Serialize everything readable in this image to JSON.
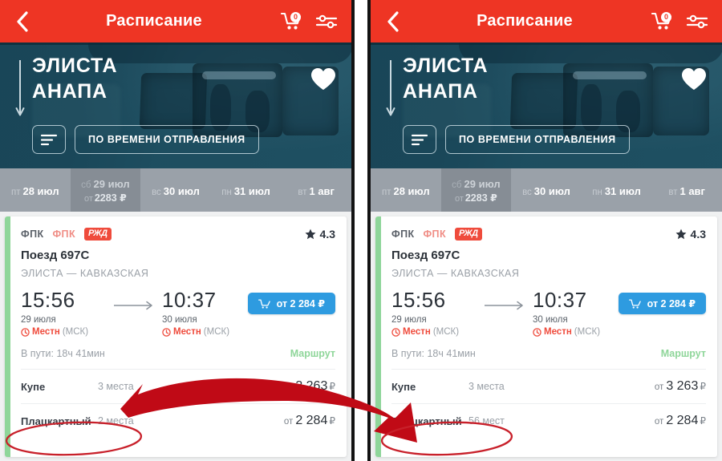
{
  "appbar": {
    "title": "Расписание",
    "back_icon": "chevron-left-icon",
    "cart_icon": "shopping-cart-icon",
    "cart_count": "0",
    "filter_icon": "sliders-filter-icon"
  },
  "hero": {
    "origin": "ЭЛИСТА",
    "destination": "АНАПА",
    "direction_icon": "arrow-down-icon",
    "favorite_icon": "heart-filled-icon",
    "sort_icon": "sort-lines-icon",
    "sort_label": "ПО ВРЕМЕНИ ОТПРАВЛЕНИЯ"
  },
  "dates": [
    {
      "dow": "пт",
      "day": "28 июл",
      "price_prefix": "",
      "price": "",
      "selected": false
    },
    {
      "dow": "сб",
      "day": "29 июл",
      "price_prefix": "от",
      "price": "2283 ₽",
      "selected": true
    },
    {
      "dow": "вс",
      "day": "30 июл",
      "price_prefix": "",
      "price": "",
      "selected": false
    },
    {
      "dow": "пн",
      "day": "31 июл",
      "price_prefix": "",
      "price": "",
      "selected": false
    },
    {
      "dow": "вт",
      "day": "1 авг",
      "price_prefix": "",
      "price": "",
      "selected": false
    }
  ],
  "card": {
    "carrier_1": "ФПК",
    "carrier_2": "ФПК",
    "carrier_logo": "РЖД",
    "rating_icon": "star-filled-icon",
    "rating": "4.3",
    "train_number": "Поезд 697С",
    "train_route": "ЭЛИСТА — КАВКАЗСКАЯ",
    "depart_time": "15:56",
    "depart_date": "29 июля",
    "depart_zone_icon": "clock-icon",
    "depart_zone": "Местн",
    "depart_zone_note": "(МСК)",
    "arrive_time": "10:37",
    "arrive_date": "30 июля",
    "arrive_zone_icon": "clock-icon",
    "arrive_zone": "Местн",
    "arrive_zone_note": "(МСК)",
    "transition_icon": "arrow-right-icon",
    "buy_icon": "shopping-cart-icon",
    "buy_label": "от 2 284 ₽",
    "duration": "В пути: 18ч 41мин",
    "route_link": "Маршрут"
  },
  "classes_left": [
    {
      "name": "Купе",
      "seats": "3 места",
      "price_prefix": "от",
      "price": "3 263",
      "currency": "₽"
    },
    {
      "name": "Плацкартный",
      "seats": "2 места",
      "price_prefix": "от",
      "price": "2 284",
      "currency": "₽"
    }
  ],
  "classes_right": [
    {
      "name": "Купе",
      "seats": "3 места",
      "price_prefix": "от",
      "price": "3 263",
      "currency": "₽"
    },
    {
      "name": "Плацкартный",
      "seats": "56 мест",
      "price_prefix": "от",
      "price": "2 284",
      "currency": "₽"
    }
  ],
  "annotations": {
    "arrow": "red-curved-arrow",
    "ellipse_left": "red-ellipse-highlight",
    "ellipse_right": "red-ellipse-highlight",
    "accent_red": "#C00A16",
    "accent_ellipse": "#C8202A"
  },
  "colors": {
    "appbar": "#EE3524",
    "hero": "#1F4D5F",
    "dates": "#9AA1A9",
    "dates_selected": "#868D95",
    "card_stripe": "#8FD69A",
    "buy_button": "#2E9BE0",
    "rzd_red": "#EF4B3C"
  }
}
